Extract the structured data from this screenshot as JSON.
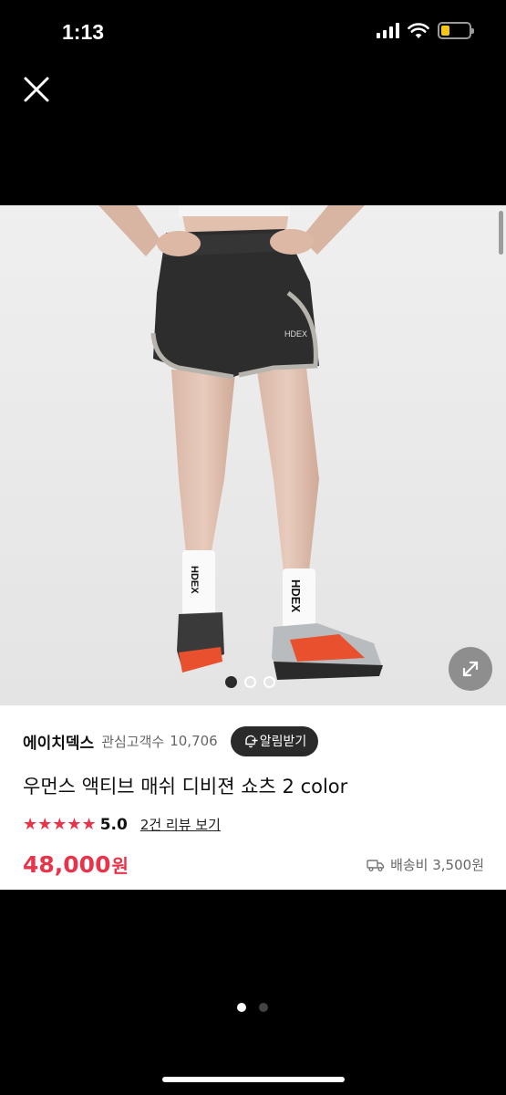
{
  "status_bar": {
    "time": "1:13",
    "battery_level": 0.3,
    "battery_color": "#f5c518"
  },
  "icons": {
    "close": "close-icon",
    "expand": "expand-icon",
    "bell": "bell-plus-icon",
    "truck": "truck-icon",
    "signal": "signal-icon",
    "wifi": "wifi-icon",
    "battery": "battery-icon"
  },
  "gallery": {
    "image_count": 3,
    "active_index": 0
  },
  "product": {
    "brand": "에이치덱스",
    "watch_label": "관심고객수",
    "watch_count": "10,706",
    "alert_button": "알림받기",
    "title": "우먼스 액티브 매쉬 디비젼 쇼츠 2 color",
    "stars": "★★★★★",
    "rating": "5.0",
    "review_link": "2건 리뷰 보기",
    "price": "48,000",
    "price_unit": "원",
    "shipping": "배송비 3,500원",
    "accent_color": "#e8344a"
  },
  "pager": {
    "page_count": 2,
    "active_page": 0
  }
}
